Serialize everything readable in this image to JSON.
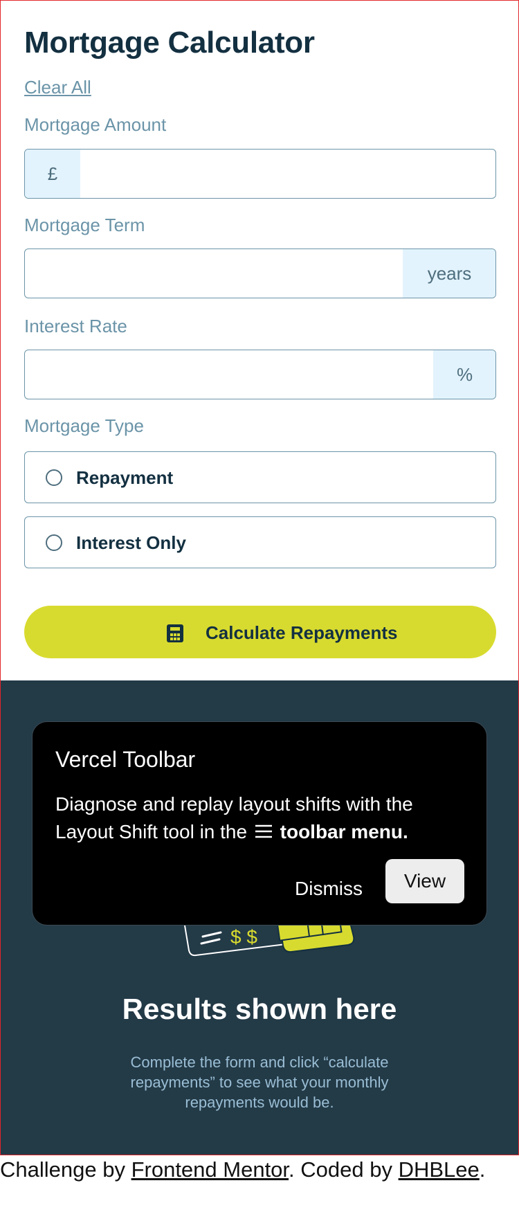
{
  "form": {
    "title": "Mortgage Calculator",
    "clear_all": "Clear All",
    "amount": {
      "label": "Mortgage Amount",
      "prefix": "£",
      "value": ""
    },
    "term": {
      "label": "Mortgage Term",
      "suffix": "years",
      "value": ""
    },
    "rate": {
      "label": "Interest Rate",
      "suffix": "%",
      "value": ""
    },
    "type": {
      "label": "Mortgage Type",
      "options": [
        {
          "label": "Repayment",
          "selected": false
        },
        {
          "label": "Interest Only",
          "selected": false
        }
      ]
    },
    "submit": {
      "label": "Calculate Repayments",
      "icon": "calculator-icon"
    }
  },
  "results": {
    "title": "Results shown here",
    "description": "Complete the form and click “calculate repayments” to see what your monthly repayments would be."
  },
  "toast": {
    "title": "Vercel Toolbar",
    "message_before": "Diagnose and replay layout shifts with the Layout Shift tool in the",
    "message_bold": "toolbar menu.",
    "menu_icon": "menu-icon",
    "dismiss": "Dismiss",
    "view": "View"
  },
  "footer": {
    "prefix": "Challenge by ",
    "link1": "Frontend Mentor",
    "middle": ". Coded by ",
    "link2": "DHBLee",
    "suffix": "."
  },
  "colors": {
    "accent": "#d8db2f",
    "dark": "#133041",
    "results_bg": "#233a47",
    "label": "#6b94a8",
    "addon_bg": "#e3f3fd"
  }
}
